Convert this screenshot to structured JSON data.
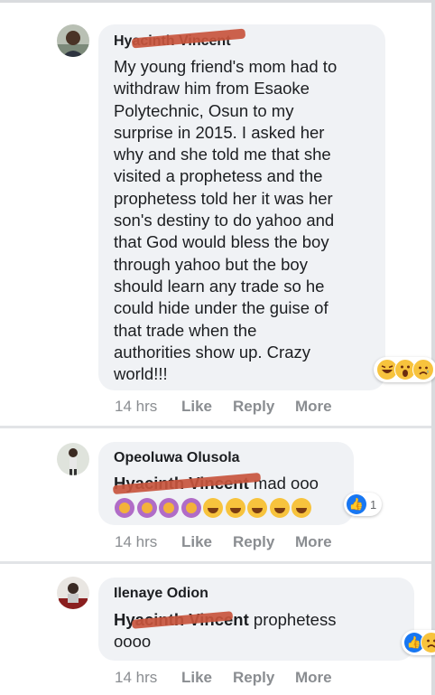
{
  "comments": [
    {
      "author": "Hyacinth Vincent",
      "text": "My young friend's mom had to withdraw him from Esaoke Polytechnic, Osun to my surprise in 2015. I asked her why and she told me that she visited a prophetess and the prophetess told her it was her son's destiny to do yahoo and that God would bless the boy through yahoo but the boy should learn any trade so he could hide under the guise of that trade when the authorities show up. Crazy world!!!",
      "lines": [
        "My young friend's mom had to",
        "withdraw him from Esaoke",
        "Polytechnic, Osun to my",
        "surprise in 2015. I asked her",
        "why and she told me that she",
        "visited a prophetess and the",
        "prophetess told her it was her",
        "son's destiny to do yahoo and",
        "that God would bless the boy",
        "through yahoo but the boy",
        "should learn any trade so he",
        "could hide under the guise of",
        "that trade when the",
        "authorities show up. Crazy",
        "world!!!"
      ],
      "time": "14 hrs",
      "like": "Like",
      "reply": "Reply",
      "more": "More",
      "reactions": [
        "haha-icon",
        "wow-icon",
        "sad-icon"
      ]
    },
    {
      "author": "Opeoluwa Olusola",
      "mention": "Hyacinth Vincent",
      "text": "mad ooo",
      "emojis": [
        "facepalm",
        "facepalm",
        "facepalm",
        "facepalm",
        "laugh",
        "laugh",
        "laugh",
        "laugh",
        "laugh"
      ],
      "reaction_count": "1",
      "time": "14 hrs",
      "like": "Like",
      "reply": "Reply",
      "more": "More"
    },
    {
      "author": "Ilenaye Odion",
      "mention": "Hyacinth Vincent",
      "text_line1": "prophetess",
      "text_line2": "oooo",
      "time": "14 hrs",
      "like": "Like",
      "reply": "Reply",
      "more": "More"
    }
  ],
  "colors": {
    "bubble": "#f0f2f5",
    "action": "#8a8d91",
    "redaction": "#c8553d",
    "like_blue": "#1877f2"
  }
}
